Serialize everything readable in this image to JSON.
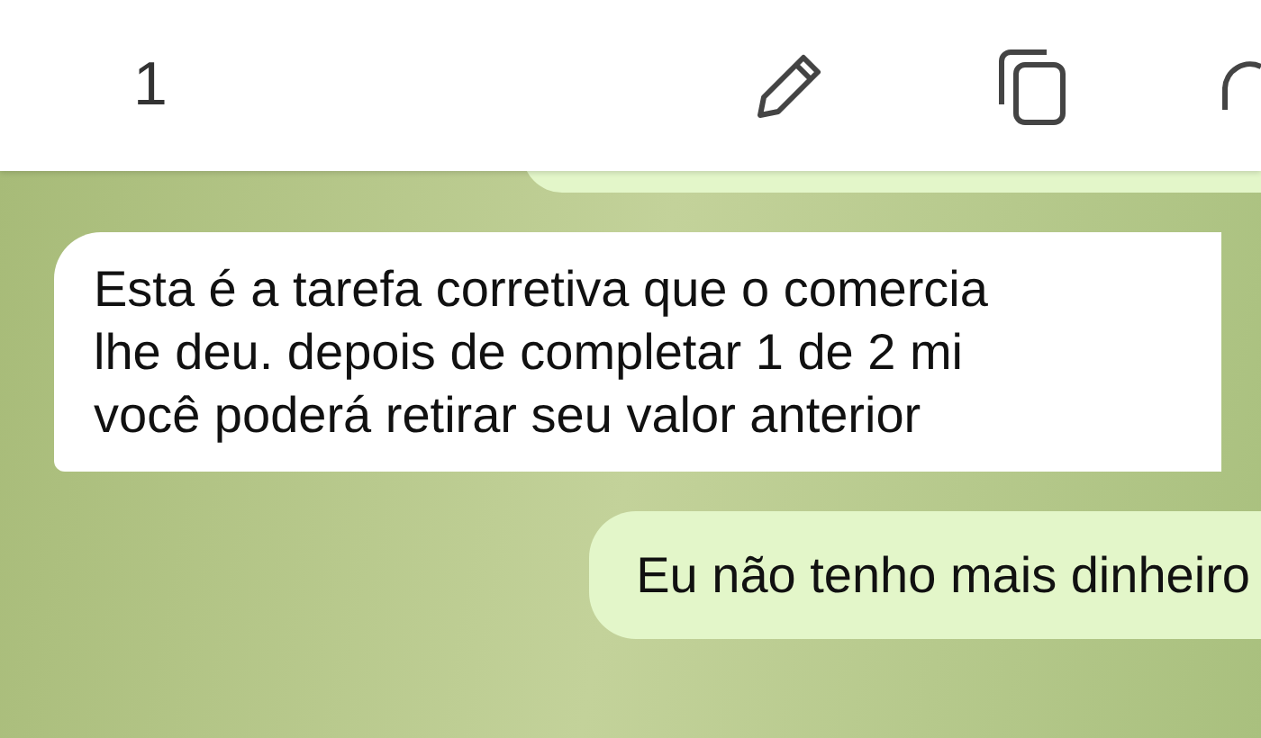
{
  "toolbar": {
    "selected_count": "1"
  },
  "messages": [
    {
      "kind": "outgoing"
    },
    {
      "kind": "incoming",
      "lines": [
        "Esta é a tarefa corretiva que o comercia",
        "lhe deu. depois de completar 1 de 2 mi",
        "você poderá retirar seu valor anterior"
      ]
    },
    {
      "kind": "outgoing",
      "lines": [
        "Eu não tenho mais dinheiro"
      ]
    }
  ]
}
